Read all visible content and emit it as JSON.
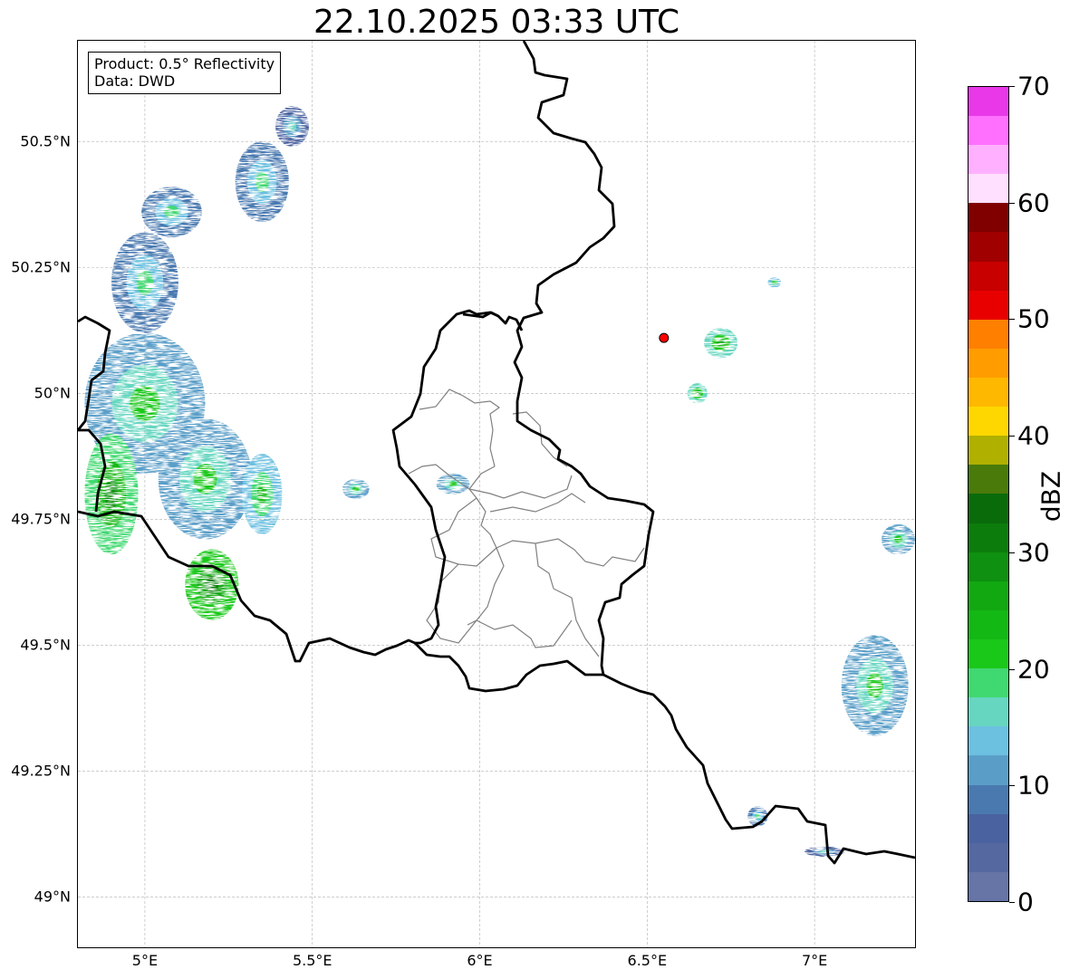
{
  "title": "22.10.2025 03:33 UTC",
  "info_box": {
    "product": "Product: 0.5° Reflectivity",
    "data": "Data: DWD"
  },
  "map": {
    "extent": {
      "lon": [
        4.8,
        7.3
      ],
      "lat": [
        48.9,
        50.7
      ]
    },
    "lat_ticks": [
      {
        "value": 50.5,
        "label": "50.5°N"
      },
      {
        "value": 50.25,
        "label": "50.25°N"
      },
      {
        "value": 50.0,
        "label": "50°N"
      },
      {
        "value": 49.75,
        "label": "49.75°N"
      },
      {
        "value": 49.5,
        "label": "49.5°N"
      },
      {
        "value": 49.25,
        "label": "49.25°N"
      },
      {
        "value": 49.0,
        "label": "49°N"
      }
    ],
    "lon_ticks": [
      {
        "value": 5.0,
        "label": "5°E"
      },
      {
        "value": 5.5,
        "label": "5.5°E"
      },
      {
        "value": 6.0,
        "label": "6°E"
      },
      {
        "value": 6.5,
        "label": "6.5°E"
      },
      {
        "value": 7.0,
        "label": "7°E"
      }
    ],
    "grid": true,
    "marker": {
      "lon": 6.55,
      "lat": 50.11,
      "color": "#ff0000"
    },
    "colors": {
      "country_border": "#000000",
      "district_border": "#808080",
      "grid": "#b0b0b0"
    }
  },
  "colorbar": {
    "label": "dBZ",
    "min": 0,
    "max": 70,
    "tick_labels": [
      "0",
      "10",
      "20",
      "30",
      "40",
      "50",
      "60",
      "70"
    ],
    "colors": [
      "#6674a6",
      "#5568a0",
      "#4a62a0",
      "#4a79b0",
      "#5a9ec8",
      "#6cc0e0",
      "#66d6c0",
      "#40d870",
      "#1ac81a",
      "#14b814",
      "#12a812",
      "#0f9010",
      "#0c7c0c",
      "#0a6b0a",
      "#4a7a0a",
      "#b0b000",
      "#ffd700",
      "#ffb800",
      "#ff9c00",
      "#ff8000",
      "#e80000",
      "#c80000",
      "#a00000",
      "#800000",
      "#ffe0ff",
      "#ffb0ff",
      "#ff70ff",
      "#e838e8"
    ]
  },
  "radar_cells": [
    {
      "lon": 5.08,
      "lat": 50.36,
      "rx": 0.09,
      "ry": 0.05,
      "dbz": 8
    },
    {
      "lon": 5.35,
      "lat": 50.42,
      "rx": 0.08,
      "ry": 0.08,
      "dbz": 8
    },
    {
      "lon": 5.44,
      "lat": 50.53,
      "rx": 0.05,
      "ry": 0.04,
      "dbz": 7
    },
    {
      "lon": 5.0,
      "lat": 50.22,
      "rx": 0.1,
      "ry": 0.1,
      "dbz": 8
    },
    {
      "lon": 5.0,
      "lat": 49.98,
      "rx": 0.18,
      "ry": 0.14,
      "dbz": 10
    },
    {
      "lon": 4.9,
      "lat": 49.8,
      "rx": 0.08,
      "ry": 0.12,
      "dbz": 18
    },
    {
      "lon": 5.18,
      "lat": 49.83,
      "rx": 0.14,
      "ry": 0.12,
      "dbz": 12
    },
    {
      "lon": 5.2,
      "lat": 49.62,
      "rx": 0.08,
      "ry": 0.07,
      "dbz": 20
    },
    {
      "lon": 5.35,
      "lat": 49.8,
      "rx": 0.06,
      "ry": 0.08,
      "dbz": 14
    },
    {
      "lon": 5.63,
      "lat": 49.81,
      "rx": 0.04,
      "ry": 0.02,
      "dbz": 12
    },
    {
      "lon": 5.92,
      "lat": 49.82,
      "rx": 0.05,
      "ry": 0.02,
      "dbz": 12
    },
    {
      "lon": 6.72,
      "lat": 50.1,
      "rx": 0.05,
      "ry": 0.03,
      "dbz": 16
    },
    {
      "lon": 6.65,
      "lat": 50.0,
      "rx": 0.03,
      "ry": 0.02,
      "dbz": 16
    },
    {
      "lon": 6.88,
      "lat": 50.22,
      "rx": 0.02,
      "ry": 0.01,
      "dbz": 14
    },
    {
      "lon": 7.18,
      "lat": 49.42,
      "rx": 0.1,
      "ry": 0.1,
      "dbz": 10
    },
    {
      "lon": 7.25,
      "lat": 49.71,
      "rx": 0.05,
      "ry": 0.03,
      "dbz": 12
    },
    {
      "lon": 6.83,
      "lat": 49.16,
      "rx": 0.03,
      "ry": 0.02,
      "dbz": 9
    },
    {
      "lon": 7.03,
      "lat": 49.09,
      "rx": 0.06,
      "ry": 0.01,
      "dbz": 7
    }
  ]
}
